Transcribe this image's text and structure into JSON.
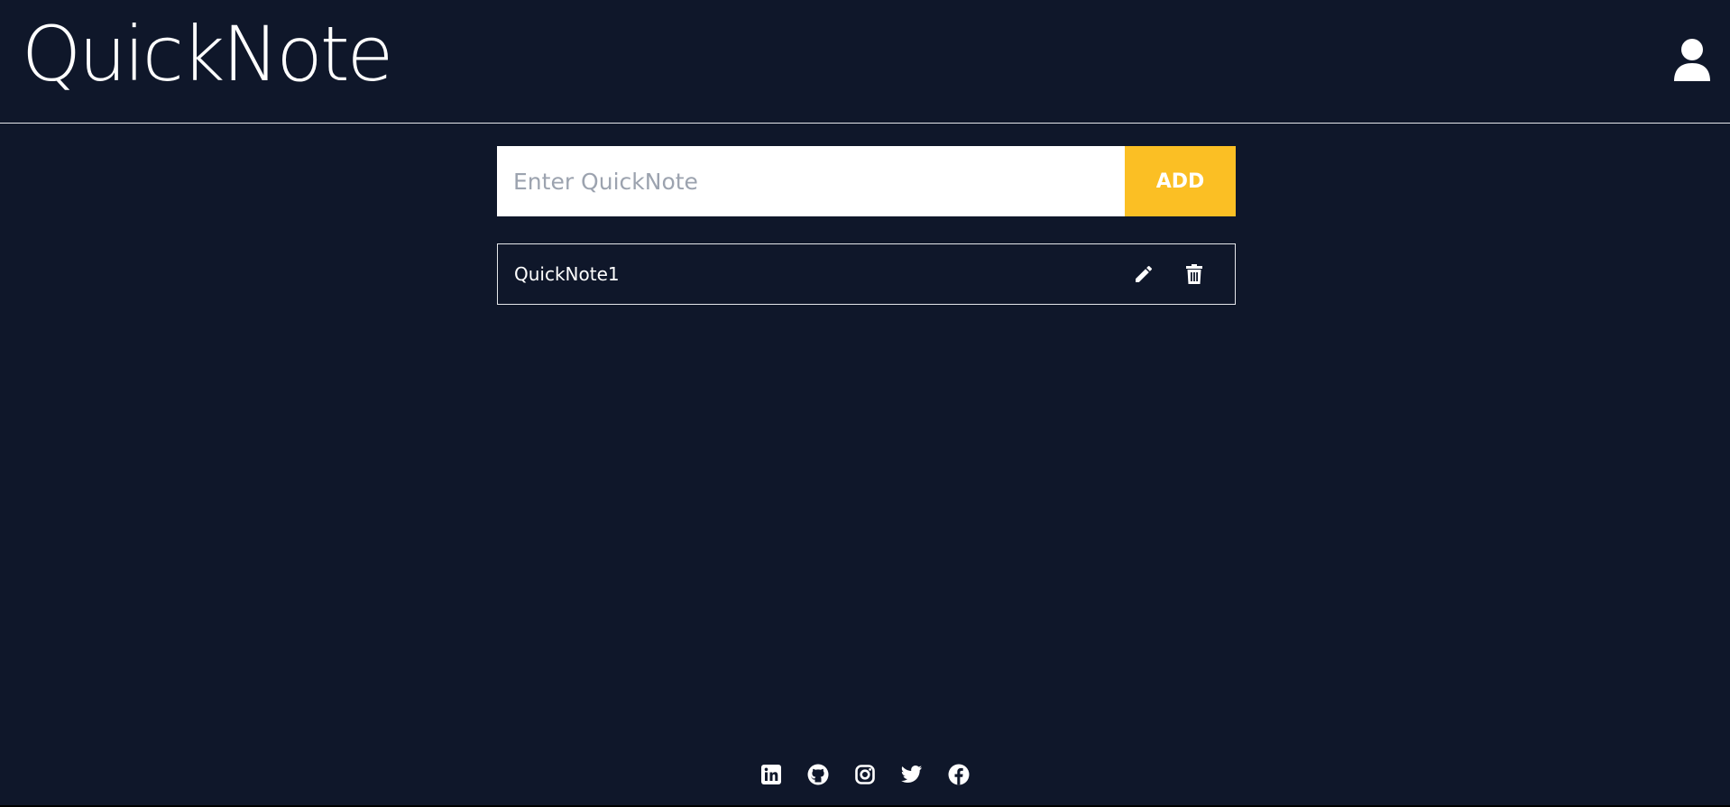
{
  "header": {
    "app_title": "QuickNote",
    "user_icon": "user-icon"
  },
  "form": {
    "input_value": "",
    "input_placeholder": "Enter QuickNote",
    "add_label": "ADD"
  },
  "notes": [
    {
      "text": "QuickNote1",
      "edit_icon": "pencil-icon",
      "delete_icon": "trash-icon"
    }
  ],
  "footer": {
    "social_icons": [
      "linkedin-icon",
      "github-icon",
      "instagram-icon",
      "twitter-icon",
      "facebook-icon"
    ]
  },
  "colors": {
    "background": "#0f172a",
    "accent": "#fbbf24",
    "text": "#ffffff",
    "border": "#e5e7eb"
  }
}
